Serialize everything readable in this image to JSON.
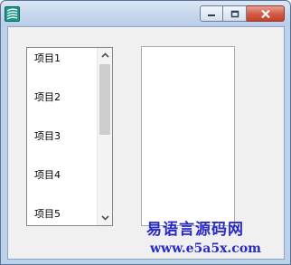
{
  "window": {
    "icon": "app-logo-icon",
    "controls": {
      "minimize": "minimize-icon",
      "maximize": "maximize-icon",
      "close": "close-icon"
    }
  },
  "listbox": {
    "items": [
      "项目1",
      "项目2",
      "项目3",
      "项目4",
      "项目5"
    ],
    "scroll_position": 0.0
  },
  "editbox": {
    "value": ""
  },
  "watermark": {
    "line1": "易语言源码网",
    "line2": "www.e5a5x.com",
    "color": "#2a2ac8"
  }
}
